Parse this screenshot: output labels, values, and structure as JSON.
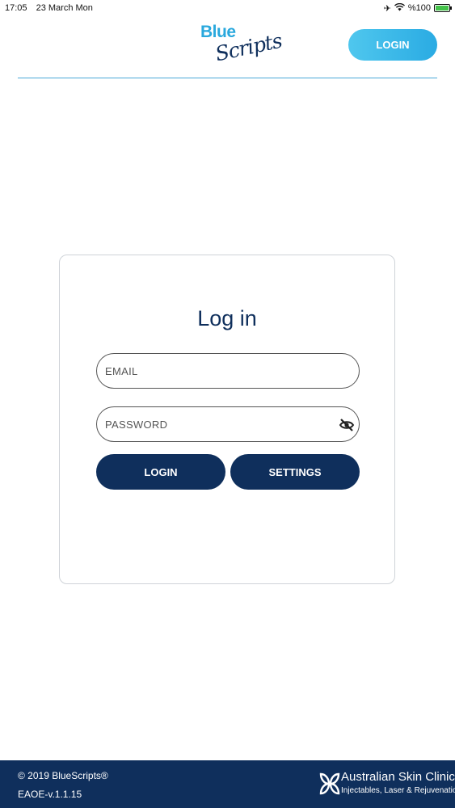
{
  "status_bar": {
    "time": "17:05",
    "date": "23 March Mon",
    "battery_text": "%100"
  },
  "header": {
    "logo_blue": "Blue",
    "logo_scripts": "Scripts",
    "login_label": "LOGIN"
  },
  "login_card": {
    "title": "Log in",
    "email_placeholder": "EMAIL",
    "password_placeholder": "PASSWORD",
    "login_button": "LOGIN",
    "settings_button": "SETTINGS"
  },
  "footer": {
    "copyright": "© 2019 BlueScripts®",
    "version": "EAOE-v.1.1.15",
    "clinic_name": "Australian Skin Clinics™",
    "clinic_tagline": "Injectables, Laser & Rejuvenation"
  },
  "colors": {
    "accent": "#29a8dd",
    "navy": "#0f2f5c"
  },
  "icons": {
    "airplane": "airplane-icon",
    "wifi": "wifi-icon",
    "battery": "battery-icon",
    "eye_toggle": "eye-off-icon"
  }
}
